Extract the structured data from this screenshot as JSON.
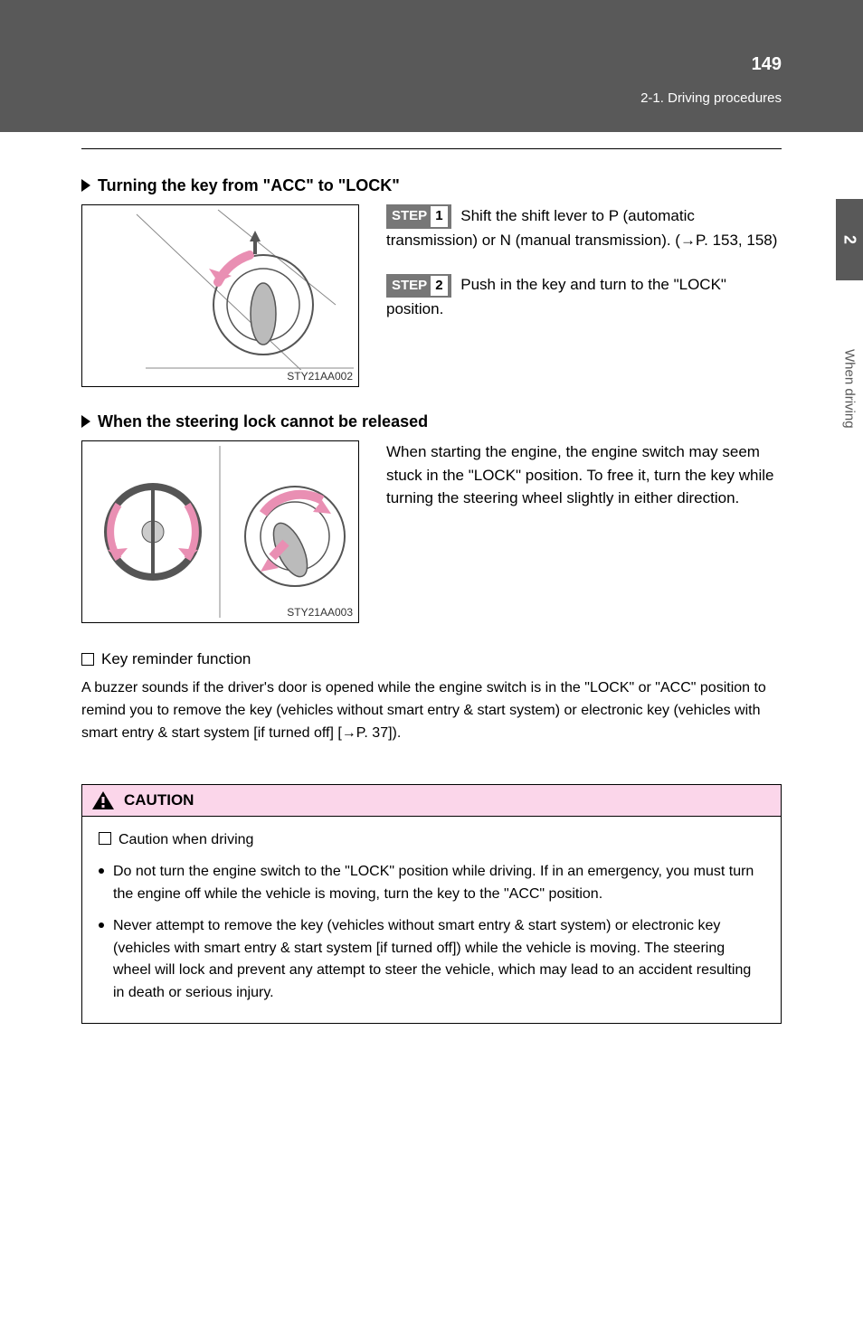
{
  "header": {
    "page_number": "149",
    "section_path": "2-1. Driving procedures"
  },
  "side": {
    "tab": "2",
    "label": "When driving"
  },
  "section1": {
    "heading": "Turning the key from \"ACC\" to \"LOCK\"",
    "figure_caption": "STY21AA002",
    "step1_label": "STEP",
    "step1_num": "1",
    "step1_text_a": "Shift the shift lever to P (automatic transmission) or N (manual transmission). (",
    "step1_arrow": "→",
    "step1_text_b": "P. 153, 158)",
    "step2_label": "STEP",
    "step2_num": "2",
    "step2_text": "Push in the key and turn to the \"LOCK\" position."
  },
  "section2": {
    "heading": "When the steering lock cannot be released",
    "figure_caption": "STY21AA003",
    "body": "When starting the engine, the engine switch may seem stuck in the \"LOCK\" position. To free it, turn the key while turning the steering wheel slightly in either direction."
  },
  "info": {
    "heading": "Key reminder function",
    "body_a": "A buzzer sounds if the driver's door is opened while the engine switch is in the \"LOCK\" or \"ACC\" position to remind you to remove the key (vehicles without smart entry & start system) or electronic key (vehicles with smart entry & start system [if turned off] [",
    "arrow": "→",
    "body_b": "P. 37])."
  },
  "caution": {
    "title": "CAUTION",
    "sub_heading": "Caution when driving",
    "bullet1": "Do not turn the engine switch to the \"LOCK\" position while driving. If in an emergency, you must turn the engine off while the vehicle is moving, turn the key to the \"ACC\" position.",
    "bullet2": "Never attempt to remove the key (vehicles without smart entry & start system) or electronic key (vehicles with smart entry & start system [if turned off]) while the vehicle is moving. The steering wheel will lock and prevent any attempt to steer the vehicle, which may lead to an accident resulting in death or serious injury."
  }
}
